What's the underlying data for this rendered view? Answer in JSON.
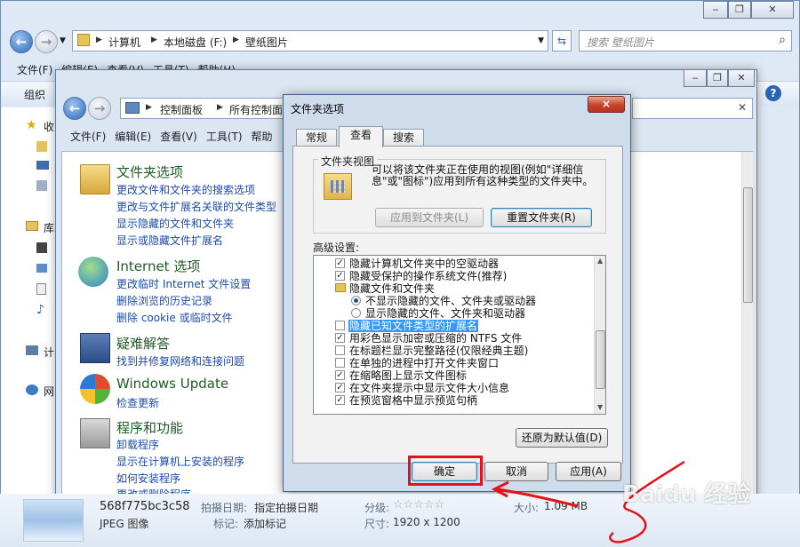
{
  "outer": {
    "address": [
      "计算机",
      "本地磁盘 (F:)",
      "壁纸图片"
    ],
    "search_placeholder": "搜索 壁纸图片",
    "menu": [
      "文件(F)",
      "编辑(E)",
      "查看(V)",
      "工具(T)",
      "帮助(H)"
    ],
    "toolbar_label": "组织",
    "nav_labels": [
      "收",
      "库",
      "计",
      "网"
    ]
  },
  "cp": {
    "address": [
      "控制面板",
      "所有控制面板"
    ],
    "menu": [
      "文件(F)",
      "编辑(E)",
      "查看(V)",
      "工具(T)",
      "帮助"
    ],
    "categories": [
      {
        "title": "文件夹选项",
        "links": [
          "更改文件和文件夹的搜索选项",
          "更改与文件扩展名关联的文件类型",
          "显示隐藏的文件和文件夹",
          "显示或隐藏文件扩展名"
        ]
      },
      {
        "title": "Internet 选项",
        "links": [
          "更改临时 Internet 文件设置",
          "删除浏览的历史记录",
          "删除 cookie 或临时文件"
        ]
      },
      {
        "title": "疑难解答",
        "links": [
          "找到并修复网络和连接问题"
        ]
      },
      {
        "title": "Windows Update",
        "links": [
          "检查更新"
        ]
      },
      {
        "title": "程序和功能",
        "links": [
          "卸载程序",
          "显示在计算机上安装的程序",
          "如何安装程序",
          "更改或删除程序"
        ]
      }
    ]
  },
  "dialog": {
    "title": "文件夹选项",
    "close_label": "×",
    "tabs": [
      "常规",
      "查看",
      "搜索"
    ],
    "folder_view": {
      "legend": "文件夹视图",
      "description": "可以将该文件夹正在使用的视图(例如\"详细信息\"或\"图标\")应用到所有这种类型的文件夹中。",
      "apply_button": "应用到文件夹(L)",
      "reset_button": "重置文件夹(R)"
    },
    "advanced_label": "高级设置:",
    "advanced_items": [
      {
        "kind": "checkbox",
        "checked": true,
        "label": "隐藏计算机文件夹中的空驱动器"
      },
      {
        "kind": "checkbox",
        "checked": true,
        "label": "隐藏受保护的操作系统文件(推荐)"
      },
      {
        "kind": "folder",
        "label": "隐藏文件和文件夹"
      },
      {
        "kind": "radio",
        "checked": true,
        "label": "不显示隐藏的文件、文件夹或驱动器"
      },
      {
        "kind": "radio",
        "checked": false,
        "label": "显示隐藏的文件、文件夹和驱动器"
      },
      {
        "kind": "checkbox",
        "checked": false,
        "selected": true,
        "label": "隐藏已知文件类型的扩展名"
      },
      {
        "kind": "checkbox",
        "checked": true,
        "label": "用彩色显示加密或压缩的 NTFS 文件"
      },
      {
        "kind": "checkbox",
        "checked": false,
        "label": "在标题栏显示完整路径(仅限经典主题)"
      },
      {
        "kind": "checkbox",
        "checked": false,
        "label": "在单独的进程中打开文件夹窗口"
      },
      {
        "kind": "checkbox",
        "checked": true,
        "label": "在缩略图上显示文件图标"
      },
      {
        "kind": "checkbox",
        "checked": true,
        "label": "在文件夹提示中显示文件大小信息"
      },
      {
        "kind": "checkbox",
        "checked": true,
        "label": "在预览窗格中显示预览句柄"
      }
    ],
    "restore_button": "还原为默认值(D)",
    "ok_button": "确定",
    "cancel_button": "取消",
    "apply_button": "应用(A)"
  },
  "details": {
    "filename": "568f775bc3c58",
    "filetype": "JPEG 图像",
    "date_label": "拍摄日期:",
    "date_value": "指定拍摄日期",
    "tags_label": "标记:",
    "tags_value": "添加标记",
    "rating_label": "分级:",
    "rating": 0,
    "size_label": "大小:",
    "size_value": "1.09 MB",
    "dims_label": "尺寸:",
    "dims_value": "1920 x 1200"
  },
  "watermark": "Baidu 经验",
  "colors": {
    "annotation": "#e8101a",
    "link": "#1c4ba8",
    "category": "#1e5d22"
  }
}
